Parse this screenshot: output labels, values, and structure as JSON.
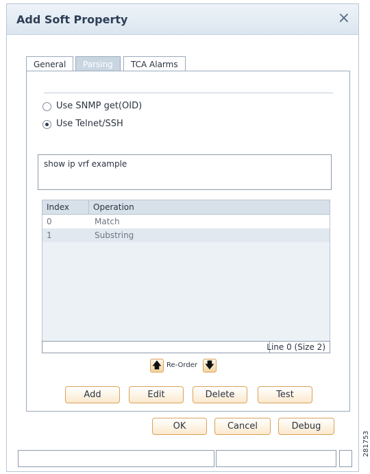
{
  "dialog": {
    "title": "Add Soft Property",
    "close_glyph": "×"
  },
  "tabs": [
    {
      "label": "General",
      "active": false
    },
    {
      "label": "Parsing",
      "active": true
    },
    {
      "label": "TCA Alarms",
      "active": false
    }
  ],
  "parsing": {
    "options": [
      {
        "label": "Use SNMP get(OID)",
        "selected": false
      },
      {
        "label": "Use Telnet/SSH",
        "selected": true
      }
    ],
    "command_text": "show ip vrf example"
  },
  "table": {
    "columns": [
      "Index",
      "Operation"
    ],
    "rows": [
      {
        "index": "0",
        "operation": "Match"
      },
      {
        "index": "1",
        "operation": "Substring"
      }
    ],
    "status": "Line 0 (Size 2)"
  },
  "reorder": {
    "label": "Re-Order",
    "up_glyph": "🡅",
    "down_glyph": "🡇"
  },
  "actions": {
    "add": "Add",
    "edit": "Edit",
    "delete": "Delete",
    "test": "Test"
  },
  "footer_buttons": {
    "ok": "OK",
    "cancel": "Cancel",
    "debug": "Debug"
  },
  "side_number": "281753",
  "colors": {
    "accent_border": "#d9a15a",
    "active_tab": "#c9d6e2",
    "header_bg": "#d8e1ea"
  }
}
